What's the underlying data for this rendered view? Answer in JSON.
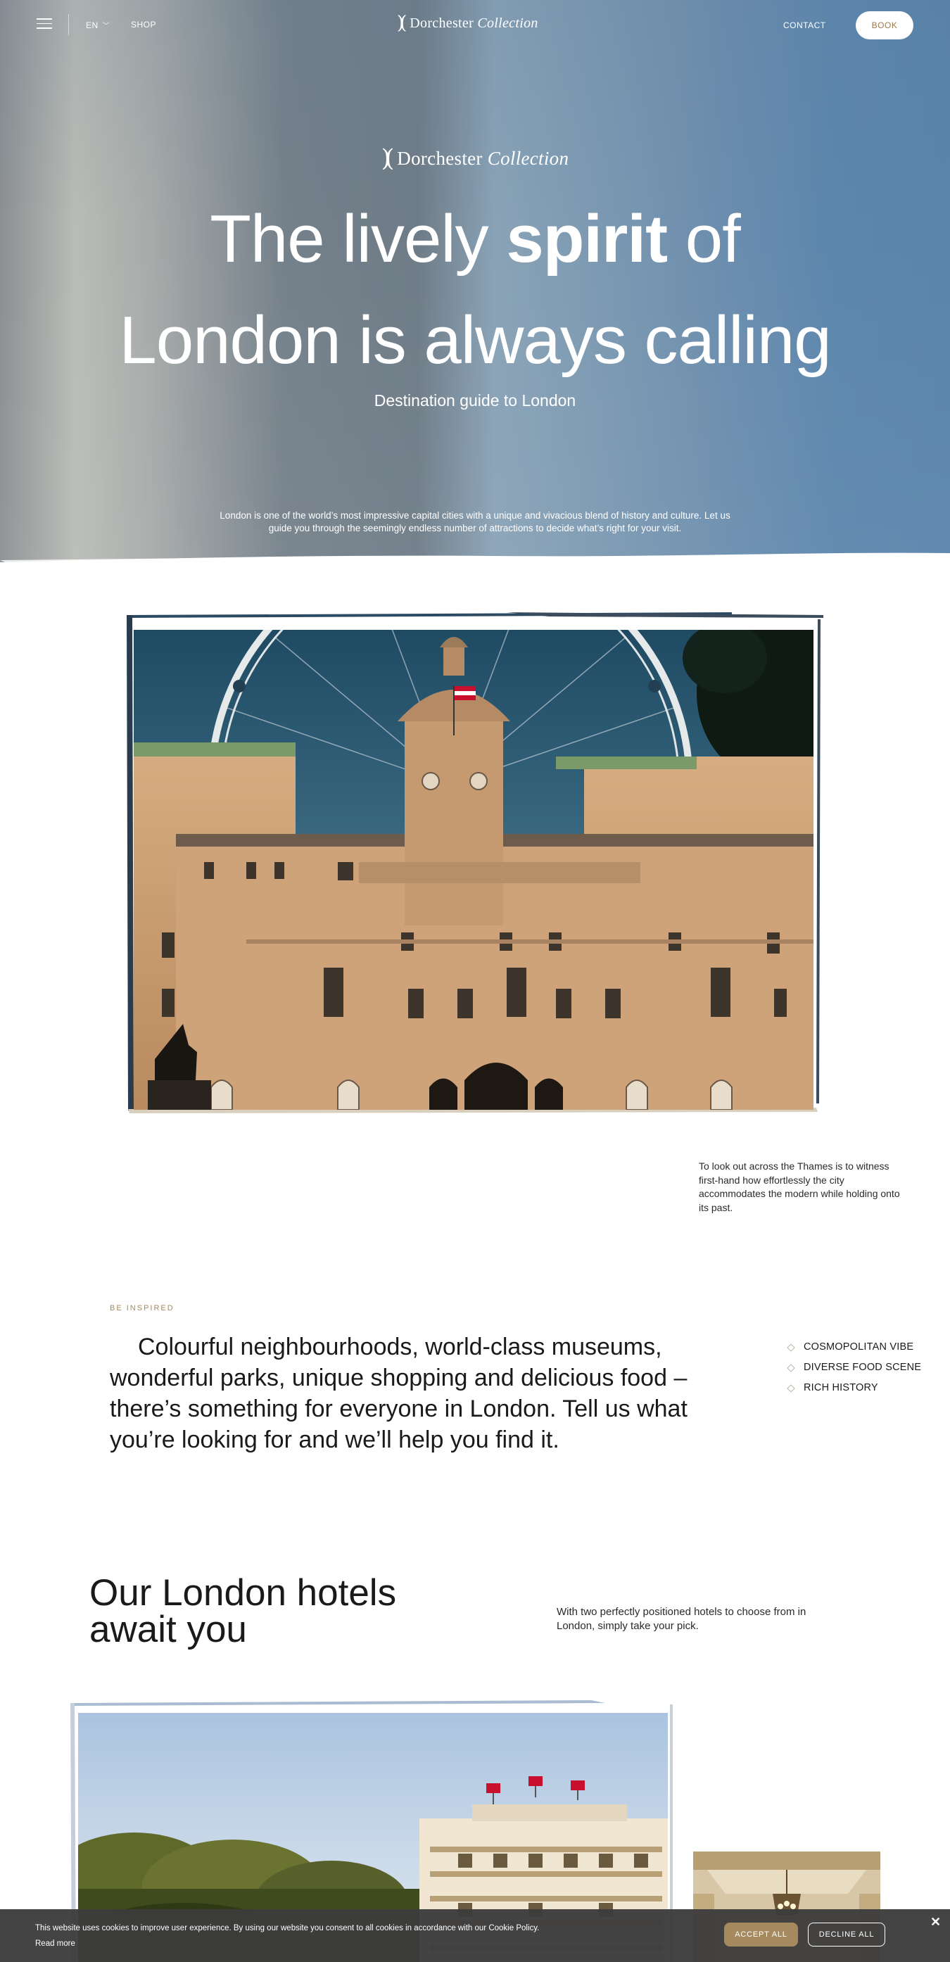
{
  "nav": {
    "language": "EN",
    "shop": "SHOP",
    "brand_main": "Dorchester",
    "brand_italic": "Collection",
    "contact": "CONTACT",
    "book": "BOOK"
  },
  "hero": {
    "brand_main": "Dorchester",
    "brand_italic": "Collection",
    "headline_pre": "The lively ",
    "headline_bold": "spirit",
    "headline_post": " of",
    "headline_line2": "London is always calling",
    "subtitle": "Destination guide to London",
    "description": "London is one of the world’s most impressive capital cities with a unique and vivacious blend of history and culture. Let us guide you through the seemingly endless number of attractions to decide what’s right for your visit."
  },
  "intro": {
    "caption": "To look out across the Thames is to witness first-hand how effortlessly the city accommodates the modern while holding onto its past."
  },
  "inspired": {
    "eyebrow": "BE INSPIRED",
    "text": "Colourful neighbourhoods, world-class museums, wonderful parks, unique shopping and delicious food – there’s something for everyone in London. Tell us what you’re looking for and we’ll help you find it.",
    "tags": [
      "COSMOPOLITAN VIBE",
      "DIVERSE FOOD SCENE",
      "RICH HISTORY"
    ]
  },
  "hotels": {
    "title": "Our London hotels await you",
    "description": "With two perfectly positioned hotels to choose from in London, simply take your pick."
  },
  "cookie": {
    "text": "This website uses cookies to improve user experience. By using our website you consent to all cookies in accordance with our Cookie Policy.",
    "read_more": "Read more",
    "accept": "ACCEPT ALL",
    "decline": "DECLINE ALL",
    "close": "✕"
  },
  "colors": {
    "accent_gold": "#a48a5e",
    "cookie_bg": "#3c3c3c",
    "book_text": "#9b7a4c"
  },
  "icons": [
    "menu-icon",
    "chevron-down-icon",
    "dorchester-logo-mark",
    "diamond-bullet-icon",
    "close-icon"
  ]
}
